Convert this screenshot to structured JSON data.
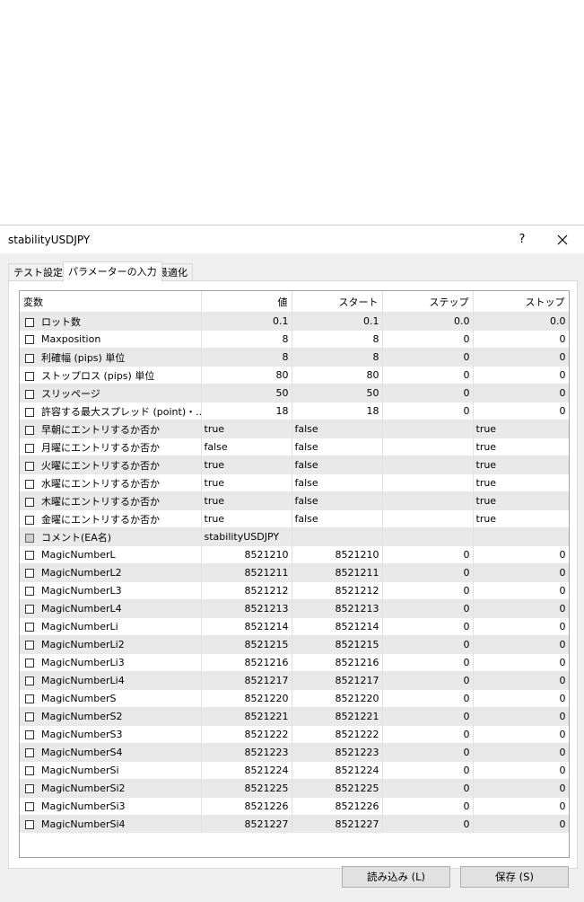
{
  "window": {
    "title": "stabilityUSDJPY",
    "help_label": "?"
  },
  "tabs": [
    {
      "label": "テスト設定"
    },
    {
      "label": "パラメーターの入力"
    },
    {
      "label": "最適化"
    }
  ],
  "table": {
    "columns": [
      "変数",
      "値",
      "スタート",
      "ステップ",
      "ストップ"
    ],
    "rows": [
      {
        "name": "ロット数",
        "value": "0.1",
        "start": "0.1",
        "step": "0.0",
        "stop": "0.0",
        "kind": "num"
      },
      {
        "name": "Maxposition",
        "value": "8",
        "start": "8",
        "step": "0",
        "stop": "0",
        "kind": "num"
      },
      {
        "name": "利確幅 (pips) 単位",
        "value": "8",
        "start": "8",
        "step": "0",
        "stop": "0",
        "kind": "num"
      },
      {
        "name": "ストップロス (pips) 単位",
        "value": "80",
        "start": "80",
        "step": "0",
        "stop": "0",
        "kind": "num"
      },
      {
        "name": "スリッページ",
        "value": "50",
        "start": "50",
        "step": "0",
        "stop": "0",
        "kind": "num"
      },
      {
        "name": "許容する最大スプレッド (point)・..",
        "value": "18",
        "start": "18",
        "step": "0",
        "stop": "0",
        "kind": "num"
      },
      {
        "name": "早朝にエントリするか否か",
        "value": "true",
        "start": "false",
        "step": "",
        "stop": "true",
        "kind": "bool"
      },
      {
        "name": "月曜にエントリするか否か",
        "value": "false",
        "start": "false",
        "step": "",
        "stop": "true",
        "kind": "bool"
      },
      {
        "name": "火曜にエントリするか否か",
        "value": "true",
        "start": "false",
        "step": "",
        "stop": "true",
        "kind": "bool"
      },
      {
        "name": "水曜にエントリするか否か",
        "value": "true",
        "start": "false",
        "step": "",
        "stop": "true",
        "kind": "bool"
      },
      {
        "name": "木曜にエントリするか否か",
        "value": "true",
        "start": "false",
        "step": "",
        "stop": "true",
        "kind": "bool"
      },
      {
        "name": "金曜にエントリするか否か",
        "value": "true",
        "start": "false",
        "step": "",
        "stop": "true",
        "kind": "bool"
      },
      {
        "name": "コメント(EA名)",
        "value": "stabilityUSDJPY",
        "start": "",
        "step": "",
        "stop": "",
        "kind": "str"
      },
      {
        "name": "MagicNumberL",
        "value": "8521210",
        "start": "8521210",
        "step": "0",
        "stop": "0",
        "kind": "num"
      },
      {
        "name": "MagicNumberL2",
        "value": "8521211",
        "start": "8521211",
        "step": "0",
        "stop": "0",
        "kind": "num"
      },
      {
        "name": "MagicNumberL3",
        "value": "8521212",
        "start": "8521212",
        "step": "0",
        "stop": "0",
        "kind": "num"
      },
      {
        "name": "MagicNumberL4",
        "value": "8521213",
        "start": "8521213",
        "step": "0",
        "stop": "0",
        "kind": "num"
      },
      {
        "name": "MagicNumberLi",
        "value": "8521214",
        "start": "8521214",
        "step": "0",
        "stop": "0",
        "kind": "num"
      },
      {
        "name": "MagicNumberLi2",
        "value": "8521215",
        "start": "8521215",
        "step": "0",
        "stop": "0",
        "kind": "num"
      },
      {
        "name": "MagicNumberLi3",
        "value": "8521216",
        "start": "8521216",
        "step": "0",
        "stop": "0",
        "kind": "num"
      },
      {
        "name": "MagicNumberLi4",
        "value": "8521217",
        "start": "8521217",
        "step": "0",
        "stop": "0",
        "kind": "num"
      },
      {
        "name": "MagicNumberS",
        "value": "8521220",
        "start": "8521220",
        "step": "0",
        "stop": "0",
        "kind": "num"
      },
      {
        "name": "MagicNumberS2",
        "value": "8521221",
        "start": "8521221",
        "step": "0",
        "stop": "0",
        "kind": "num"
      },
      {
        "name": "MagicNumberS3",
        "value": "8521222",
        "start": "8521222",
        "step": "0",
        "stop": "0",
        "kind": "num"
      },
      {
        "name": "MagicNumberS4",
        "value": "8521223",
        "start": "8521223",
        "step": "0",
        "stop": "0",
        "kind": "num"
      },
      {
        "name": "MagicNumberSi",
        "value": "8521224",
        "start": "8521224",
        "step": "0",
        "stop": "0",
        "kind": "num"
      },
      {
        "name": "MagicNumberSi2",
        "value": "8521225",
        "start": "8521225",
        "step": "0",
        "stop": "0",
        "kind": "num"
      },
      {
        "name": "MagicNumberSi3",
        "value": "8521226",
        "start": "8521226",
        "step": "0",
        "stop": "0",
        "kind": "num"
      },
      {
        "name": "MagicNumberSi4",
        "value": "8521227",
        "start": "8521227",
        "step": "0",
        "stop": "0",
        "kind": "num"
      }
    ]
  },
  "buttons": {
    "load_label": "読み込み (L)",
    "save_label": "保存 (S)"
  }
}
